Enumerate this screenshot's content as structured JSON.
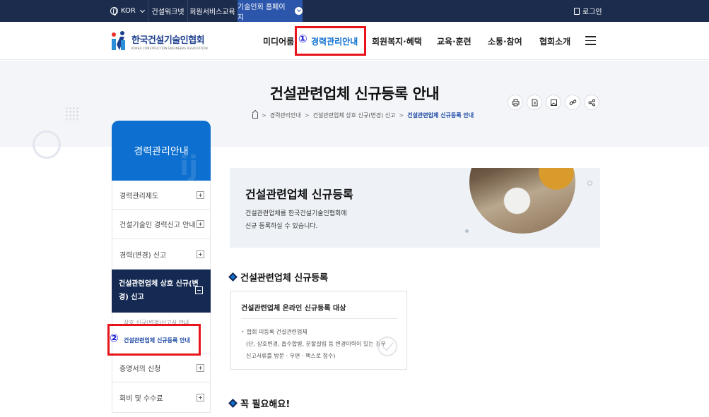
{
  "topbar": {
    "language": "KOR",
    "links": [
      "건설워크넷",
      "회원서비스교육",
      "기술인회 홈페이지"
    ],
    "login": "로그인"
  },
  "header": {
    "logo_name": "한국건설기술인협회",
    "logo_sub": "KOREA CONSTRUCTION ENGINEERS ASSOCIATION",
    "nav": [
      "미디어룸",
      "경력관리안내",
      "회원복지·혜택",
      "교육·훈련",
      "소통·참여",
      "협회소개"
    ]
  },
  "annotations": {
    "marker1": "①",
    "marker2": "②"
  },
  "page": {
    "title": "건설관련업체 신규등록 안내",
    "breadcrumb": [
      "경력관리안내",
      "건설관련업체 상호 신규(변경) 신고",
      "건설관련업체 신규등록 안내"
    ]
  },
  "sidebar": {
    "title": "경력관리안내",
    "watermark": "ij",
    "items": [
      "경력관리제도",
      "건설기술인 경력신고 안내",
      "경력(변경) 신고"
    ],
    "active": "건설관련업체 상호 신규(변경) 신고",
    "sub_items": [
      "상호 신규(변경)신고서 안내",
      "건설관련업체 신규등록 안내"
    ],
    "items_after": [
      "증명서의 신청",
      "회비 및 수수료"
    ]
  },
  "intro": {
    "title": "건설관련업체 신규등록",
    "desc_line1": "건설관련업체를 한국건설기술인협회에",
    "desc_line2": "신규 등록하실 수 있습니다."
  },
  "section1": {
    "title": "건설관련업체 신규등록",
    "card_title": "건설관련업체 온라인 신규등록 대상",
    "card_lines": [
      "협회 미등록 건설관련업체",
      "(단, 상호변경, 흡수합병, 분할설립 등 변경이력이 있는 경우",
      "신고서류를 방문 · 우편 · 팩스로 접수)"
    ]
  },
  "section2": {
    "title": "꼭 필요해요!"
  },
  "colors": {
    "topbar": "#1c2c4c",
    "accent": "#0d6fd0",
    "active_nav": "#152a52",
    "highlight": "#e8141b"
  }
}
